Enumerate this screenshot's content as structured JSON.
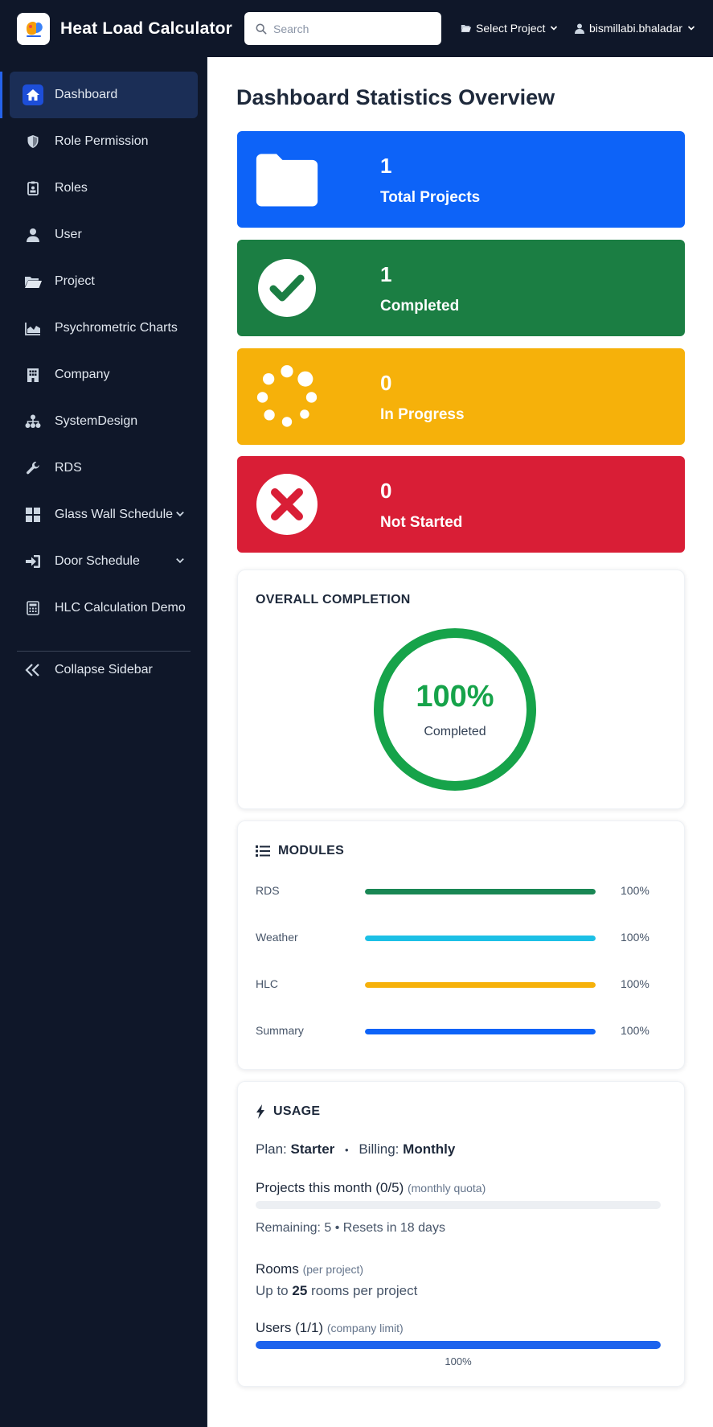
{
  "header": {
    "app_title": "Heat Load Calculator",
    "search_placeholder": "Search",
    "project_select": "Select Project",
    "username": "bismillabi.bhaladar"
  },
  "sidebar": {
    "items": [
      {
        "label": "Dashboard",
        "icon": "home-icon",
        "active": true
      },
      {
        "label": "Role Permission",
        "icon": "shield-icon"
      },
      {
        "label": "Roles",
        "icon": "id-badge-icon"
      },
      {
        "label": "User",
        "icon": "user-icon"
      },
      {
        "label": "Project",
        "icon": "folder-open-icon"
      },
      {
        "label": "Psychrometric Charts",
        "icon": "area-chart-icon"
      },
      {
        "label": "Company",
        "icon": "building-icon"
      },
      {
        "label": "SystemDesign",
        "icon": "sitemap-icon"
      },
      {
        "label": "RDS",
        "icon": "wrench-icon"
      },
      {
        "label": "Glass Wall Schedule",
        "icon": "grid-icon",
        "has_submenu": true
      },
      {
        "label": "Door Schedule",
        "icon": "sign-in-icon",
        "has_submenu": true
      },
      {
        "label": "HLC Calculation Demo",
        "icon": "calculator-icon"
      }
    ],
    "collapse_label": "Collapse Sidebar"
  },
  "main": {
    "title": "Dashboard Statistics Overview",
    "stats": [
      {
        "value": "1",
        "label": "Total Projects",
        "color": "#0d63f8",
        "icon": "folder-icon"
      },
      {
        "value": "1",
        "label": "Completed",
        "color": "#1b7e43",
        "icon": "check-circle-icon"
      },
      {
        "value": "0",
        "label": "In Progress",
        "color": "#f6b10a",
        "icon": "spinner-icon"
      },
      {
        "value": "0",
        "label": "Not Started",
        "color": "#d91e36",
        "icon": "times-circle-icon"
      }
    ],
    "completion": {
      "title": "OVERALL COMPLETION",
      "percent_text": "100%",
      "percent": 100,
      "sub": "Completed",
      "color": "#16a34a"
    },
    "modules": {
      "title": "MODULES",
      "items": [
        {
          "name": "RDS",
          "percent": 100,
          "pct_text": "100%",
          "color": "#198754"
        },
        {
          "name": "Weather",
          "percent": 100,
          "pct_text": "100%",
          "color": "#1cc0e6"
        },
        {
          "name": "HLC",
          "percent": 100,
          "pct_text": "100%",
          "color": "#f6b10a"
        },
        {
          "name": "Summary",
          "percent": 100,
          "pct_text": "100%",
          "color": "#0d63f8"
        }
      ]
    },
    "usage": {
      "title": "USAGE",
      "plan_label": "Plan:",
      "plan_value": "Starter",
      "billing_label": "Billing:",
      "billing_value": "Monthly",
      "projects_label": "Projects this month (0/5)",
      "projects_note": "(monthly quota)",
      "projects_percent": 0,
      "remaining": "Remaining: 5 • Resets in 18 days",
      "rooms_label": "Rooms",
      "rooms_note": "(per project)",
      "rooms_prefix": "Up to",
      "rooms_value": "25",
      "rooms_suffix": "rooms per project",
      "users_label": "Users (1/1)",
      "users_note": "(company limit)",
      "users_percent": 100,
      "users_pct_text": "100%"
    }
  }
}
